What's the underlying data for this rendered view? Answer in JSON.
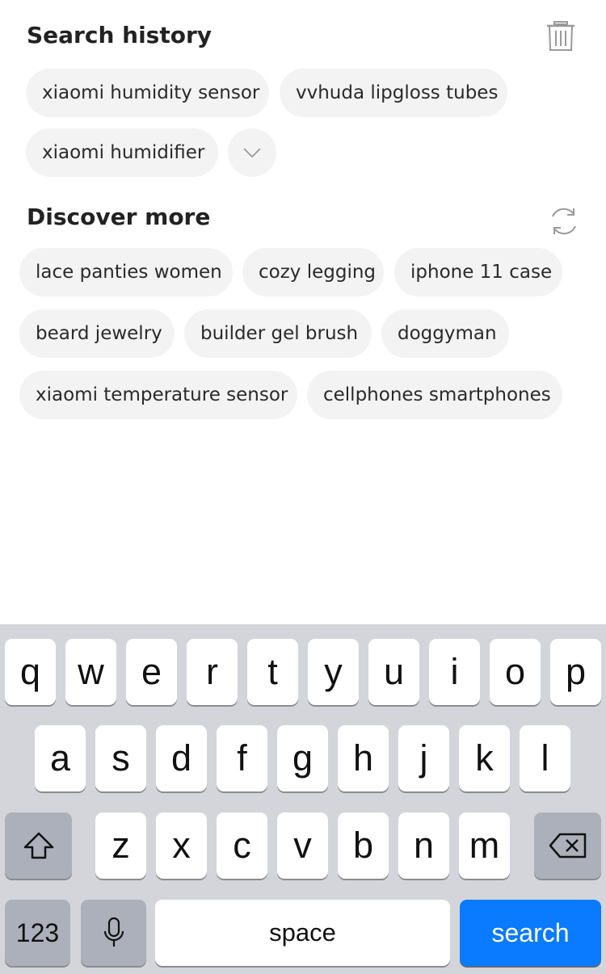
{
  "search_history": {
    "title": "Search history",
    "chips": [
      "xiaomi humidity sensor",
      "vvhuda lipgloss tubes",
      "xiaomi humidifier"
    ]
  },
  "discover_more": {
    "title": "Discover more",
    "chips": [
      "lace panties women",
      "cozy legging",
      "iphone 11 case",
      "beard jewelry",
      "builder gel brush",
      "doggyman",
      "xiaomi temperature sensor",
      "cellphones smartphones"
    ]
  },
  "icons": {
    "trash": "trash-icon",
    "refresh": "refresh-icon",
    "expand": "chevron-down-icon",
    "shift": "shift-icon",
    "backspace": "backspace-icon",
    "mic": "microphone-icon"
  },
  "keyboard": {
    "row1": [
      "q",
      "w",
      "e",
      "r",
      "t",
      "y",
      "u",
      "i",
      "o",
      "p"
    ],
    "row2": [
      "a",
      "s",
      "d",
      "f",
      "g",
      "h",
      "j",
      "k",
      "l"
    ],
    "row3": [
      "z",
      "x",
      "c",
      "v",
      "b",
      "n",
      "m"
    ],
    "numbers_label": "123",
    "space_label": "space",
    "search_label": "search"
  },
  "colors": {
    "chip_bg": "#f3f3f3",
    "keyboard_bg": "#d3d5db",
    "search_key": "#0a7aff"
  }
}
